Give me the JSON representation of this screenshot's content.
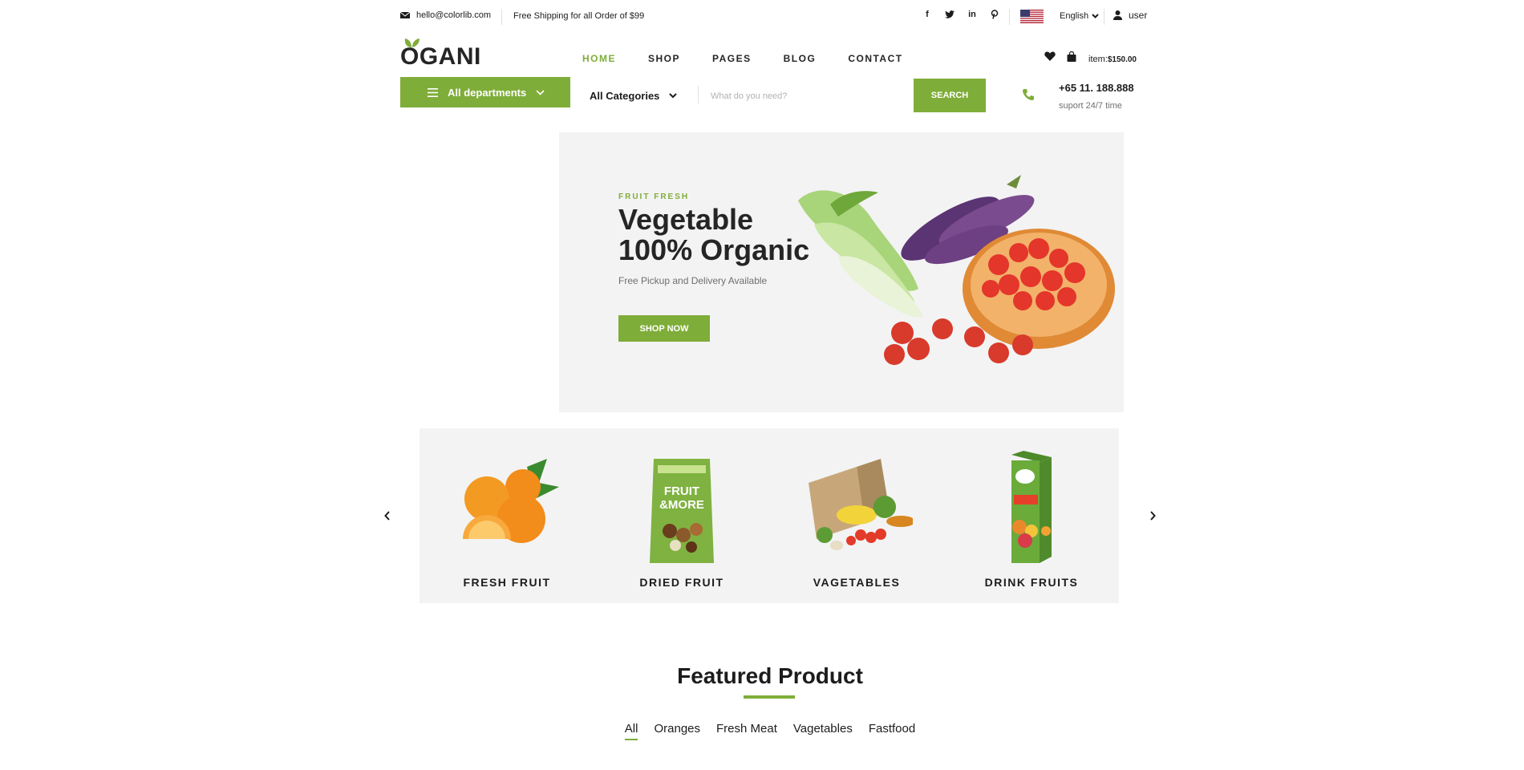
{
  "topbar": {
    "email": "hello@colorlib.com",
    "shipping": "Free Shipping for all Order of $99",
    "social_icons": [
      "facebook-icon",
      "twitter-icon",
      "linkedin-icon",
      "pinterest-icon"
    ],
    "language": "English",
    "user": "user"
  },
  "header": {
    "logo": "OGANI",
    "nav": [
      {
        "label": "HOME",
        "active": true
      },
      {
        "label": "SHOP",
        "active": false
      },
      {
        "label": "PAGES",
        "active": false
      },
      {
        "label": "BLOG",
        "active": false
      },
      {
        "label": "CONTACT",
        "active": false
      }
    ],
    "cart_item_label": "item:",
    "cart_total": "$150.00"
  },
  "search_bar": {
    "departments_label": "All departments",
    "category_label": "All Categories",
    "placeholder": "What do you need?",
    "button_label": "SEARCH",
    "phone": "+65 11. 188.888",
    "phone_sub": "suport 24/7 time"
  },
  "hero": {
    "tag": "FRUIT FRESH",
    "title_line1": "Vegetable",
    "title_line2": "100% Organic",
    "subtitle": "Free Pickup and Delivery Available",
    "button_label": "SHOP NOW"
  },
  "categories": [
    {
      "label": "FRESH FRUIT"
    },
    {
      "label": "DRIED FRUIT"
    },
    {
      "label": "VAGETABLES"
    },
    {
      "label": "DRINK FRUITS"
    }
  ],
  "featured": {
    "title": "Featured Product",
    "filters": [
      "All",
      "Oranges",
      "Fresh Meat",
      "Vagetables",
      "Fastfood"
    ],
    "active_filter": "All"
  },
  "colors": {
    "accent": "#7fad39",
    "text": "#1c1c1c",
    "muted": "#6f6f6f",
    "panel": "#f3f3f3"
  }
}
